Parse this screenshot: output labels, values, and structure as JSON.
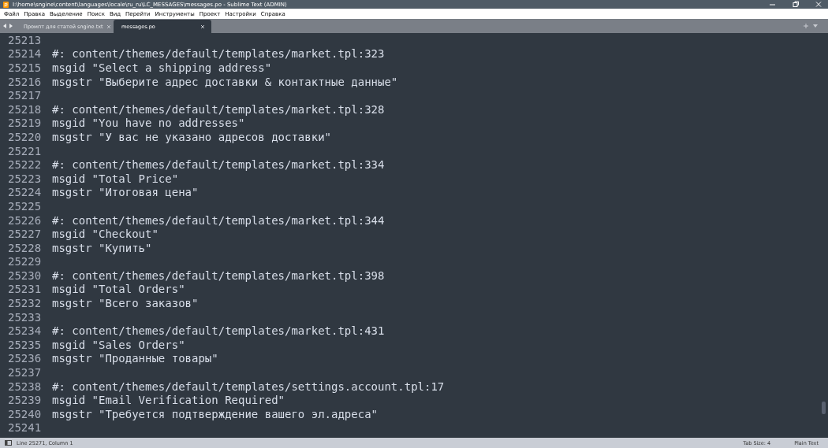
{
  "window": {
    "title": "I:\\home\\sngine\\content\\languages\\locale\\ru_ru\\LC_MESSAGES\\messages.po - Sublime Text (ADMIN)"
  },
  "menu": [
    "Файл",
    "Правка",
    "Выделение",
    "Поиск",
    "Вид",
    "Перейти",
    "Инструменты",
    "Проект",
    "Настройки",
    "Справка"
  ],
  "tabs": [
    {
      "label": "Промпт для статей sngine.txt",
      "selected": false
    },
    {
      "label": "messages.po",
      "selected": true
    }
  ],
  "lines": [
    {
      "number": "25213"
    },
    {
      "number": "25214",
      "text": "#: content/themes/default/templates/market.tpl:323"
    },
    {
      "number": "25215",
      "text": "msgid \"Select a shipping address\""
    },
    {
      "number": "25216",
      "text": "msgstr \"Выберите адрес доставки & контактные данные\""
    },
    {
      "number": "25217"
    },
    {
      "number": "25218",
      "text": "#: content/themes/default/templates/market.tpl:328"
    },
    {
      "number": "25219",
      "text": "msgid \"You have no addresses\""
    },
    {
      "number": "25220",
      "text": "msgstr \"У вас не указано адресов доставки\""
    },
    {
      "number": "25221"
    },
    {
      "number": "25222",
      "text": "#: content/themes/default/templates/market.tpl:334"
    },
    {
      "number": "25223",
      "text": "msgid \"Total Price\""
    },
    {
      "number": "25224",
      "text": "msgstr \"Итоговая цена\""
    },
    {
      "number": "25225"
    },
    {
      "number": "25226",
      "text": "#: content/themes/default/templates/market.tpl:344"
    },
    {
      "number": "25227",
      "text": "msgid \"Checkout\""
    },
    {
      "number": "25228",
      "text": "msgstr \"Купить\""
    },
    {
      "number": "25229"
    },
    {
      "number": "25230",
      "text": "#: content/themes/default/templates/market.tpl:398"
    },
    {
      "number": "25231",
      "text": "msgid \"Total Orders\""
    },
    {
      "number": "25232",
      "text": "msgstr \"Всего заказов\""
    },
    {
      "number": "25233"
    },
    {
      "number": "25234",
      "text": "#: content/themes/default/templates/market.tpl:431"
    },
    {
      "number": "25235",
      "text": "msgid \"Sales Orders\""
    },
    {
      "number": "25236",
      "text": "msgstr \"Проданные товары\""
    },
    {
      "number": "25237"
    },
    {
      "number": "25238",
      "text": "#: content/themes/default/templates/settings.account.tpl:17"
    },
    {
      "number": "25239",
      "text": "msgid \"Email Verification Required\""
    },
    {
      "number": "25240",
      "text": "msgstr \"Требуется подтверждение вашего эл.адреса\""
    },
    {
      "number": "25241"
    }
  ],
  "status_bar": {
    "position": "Line 25271, Column 1",
    "tab_size": "Tab Size: 4",
    "syntax": "Plain Text"
  }
}
